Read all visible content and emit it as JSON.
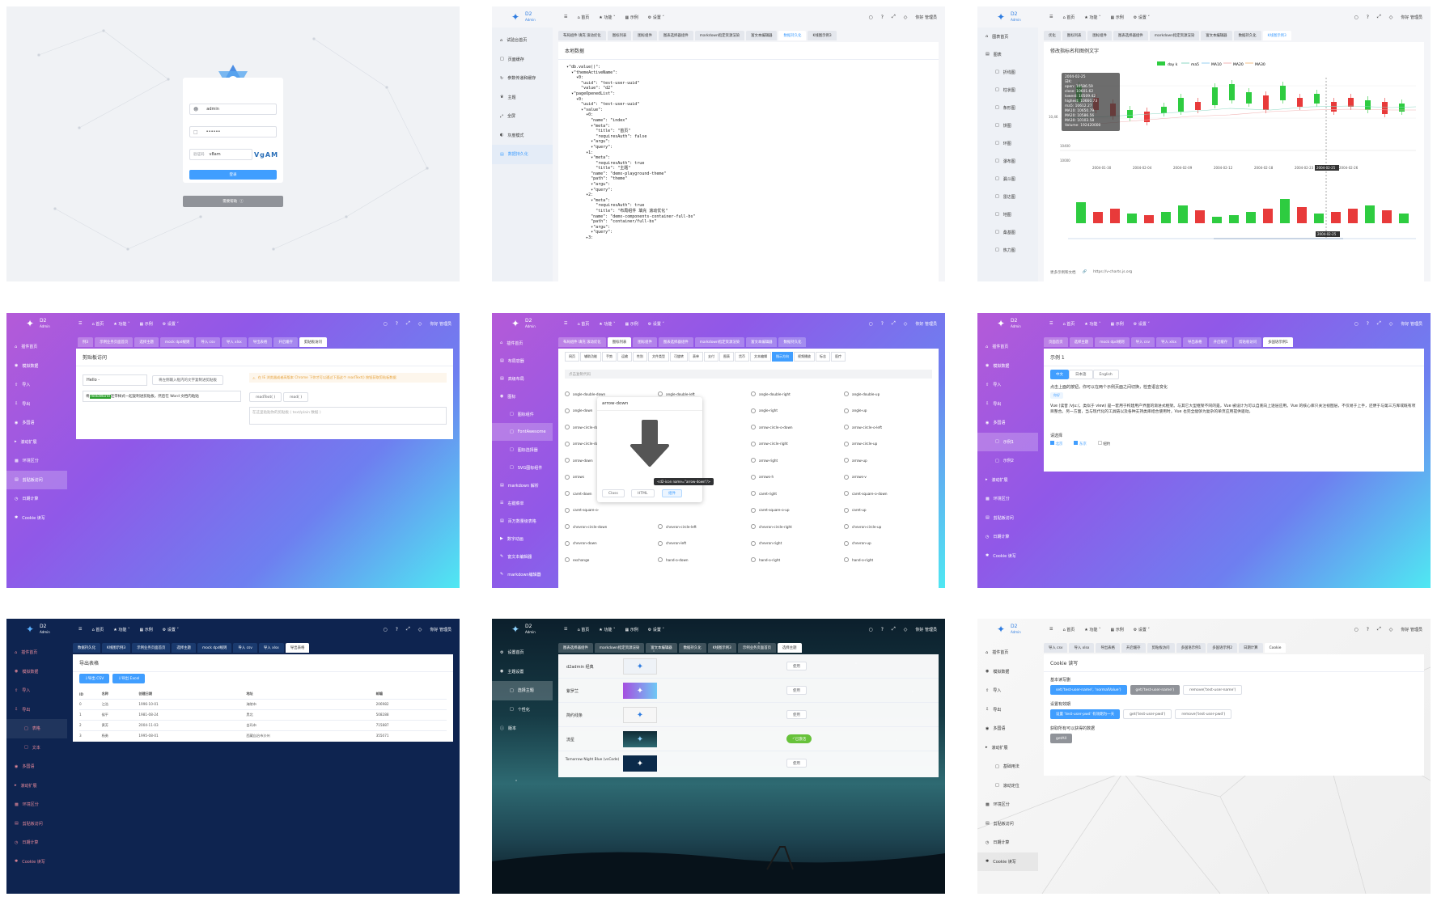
{
  "common": {
    "logo": "D2",
    "logo_sub": "Admin",
    "nav": [
      "首页",
      "功能",
      "示例",
      "设置"
    ],
    "user": "你好 管理员"
  },
  "p1": {
    "username": "admin",
    "password": "••••••",
    "code_ph": "验证码",
    "code_val": "v8am",
    "captcha": "VgAM",
    "login": "登录",
    "help": "需要帮助"
  },
  "p2": {
    "side": [
      "试验台首页",
      "页面缓存",
      "参数传递和缓存",
      "主题",
      "全屏",
      "灰度模式",
      "数据持久化"
    ],
    "tabs": [
      "布局组件 填充 滚动优化",
      "图标列表",
      "图标组件",
      "图表选择器组件",
      "markdown指定资源渲染",
      "富文本编辑器",
      "数据持久化",
      "K线图示例3"
    ],
    "title": "本地数据",
    "code": "▾\"db.value()\":\n  ▾\"themeActiveName\":\n    ▾0:\n      \"uuid\": \"test-user-uuid\"\n      \"value\": \"d2\"\n  ▾\"pageOpenedList\":\n    ▾0:\n      \"uuid\": \"test-user-uuid\"\n      ▾\"value\":\n        ▾0:\n          \"name\": \"index\"\n          ▾\"meta\":\n            \"title\": \"首页\"\n            \"requiresAuth\": false\n          ▾\"argu\":\n          ▾\"query\":\n        ▾1:\n          ▾\"meta\":\n            \"requiresAuth\": true\n            \"title\": \"主题\"\n          \"name\": \"demo-playground-theme\"\n          \"path\": \"theme\"\n          ▾\"argu\":\n          ▾\"query\":\n        ▾2:\n          ▾\"meta\":\n            \"requiresAuth\": true\n            \"title\": \"布局组件 填充 滚动优化\"\n          \"name\": \"demo-components-container-full-bs\"\n          \"path\": \"container/full-bs\"\n          ▾\"argu\":\n          ▾\"query\":\n        ▸3:"
  },
  "p3": {
    "side": [
      "图表首页",
      "图表",
      "折线图",
      "柱状图",
      "条形图",
      "饼图",
      "环图",
      "瀑布图",
      "漏斗图",
      "雷达图",
      "地图",
      "桑基图",
      "热力图"
    ],
    "tabs": [
      "优化",
      "图标列表",
      "图标组件",
      "图表选择器组件",
      "markdown指定资源渲染",
      "富文本编辑器",
      "数据持久化",
      "K线图示例3"
    ],
    "title": "修改指标名和图例文字",
    "legend": [
      "day k",
      "ma5",
      "MA10",
      "MA20",
      "MA30"
    ],
    "tip": [
      "2004-02-25",
      "日K:",
      "open: 10586.59",
      "close: 10601.62",
      "lowest: 10509.42",
      "highest: 10660.73",
      "ma5: 10612.27",
      "MA10: 10650.79",
      "MA20: 10586.56",
      "MA30: 10103.58",
      "Volume: 192420000"
    ],
    "xticks": [
      "2004-01-30",
      "2004-02-04",
      "2004-02-09",
      "2004-02-12",
      "2004-02-18",
      "2004-02-23",
      "2004-02-26"
    ],
    "yticks": [
      "10400",
      "10000"
    ],
    "marker": "2004-02-25",
    "ylabel_left": "10,46",
    "bottom_link": "更多示例和文档",
    "bottom_url": "https://v-charts.js.org"
  },
  "p4": {
    "side": [
      "插件首页",
      "模拟数据",
      "导入",
      "导出",
      "多国语",
      "滚动扩展",
      "环境区分",
      "剪贴板访问",
      "日期计算",
      "Cookie 读写"
    ],
    "tabs": [
      "例3",
      "示例业务页面首页",
      "选择主题",
      "mock dpd规则",
      "导入 csv",
      "导入 xlsx",
      "导出表格",
      "开启缓存",
      "剪贴板访问"
    ],
    "title": "剪贴板访问",
    "input": "Hello -",
    "btn1": "将左侧输入框内的文字复制进剪贴板",
    "rich_pre": "将",
    "rich_hl": "HelloWorld",
    "rich_post": "连带样式一起复制进剪贴板，然后在 Word 文档内粘贴",
    "warn": "在 IE 浏览器或者高版本 Chrome 下你才可以通过下面这个 readText() 按钮获取剪贴板数据",
    "btn2": "readText( )",
    "btn3": "read( )",
    "ta_ph": "在这里粘贴你的剪贴板 ( text/plain 数据 )"
  },
  "p5": {
    "side": [
      "插件首页",
      "布局容器",
      "高级布局",
      "图标",
      "图标组件",
      "FontAwesome",
      "图标选择器",
      "SVG图标组件",
      "markdown 解析",
      "右键菜单",
      "百万数量级表格",
      "数字动画",
      "富文本编辑器",
      "markdown编辑器"
    ],
    "tabs": [
      "布局组件 填充 滚动优化",
      "图标列表",
      "图标组件",
      "图表选择器组件",
      "markdown指定资源渲染",
      "富文本编辑器",
      "数据持久化"
    ],
    "cats": [
      "网页",
      "辅助功能",
      "手势",
      "运输",
      "性别",
      "文件类型",
      "可旋转",
      "表单",
      "支付",
      "图表",
      "货币",
      "文本编辑",
      "指示方向",
      "视频播放",
      "标志",
      "医疗"
    ],
    "search_ph": "点击复制代码",
    "icons": [
      [
        "angle-double-down",
        "angle-double-left",
        "angle-double-right",
        "angle-double-up"
      ],
      [
        "angle-down",
        "",
        "angle-right",
        "angle-up"
      ],
      [
        "arrow-circle-down",
        "",
        "arrow-circle-o-down",
        "arrow-circle-o-left"
      ],
      [
        "arrow-circle-down",
        "",
        "arrow-circle-right",
        "arrow-circle-up"
      ],
      [
        "arrow-down",
        "",
        "arrow-right",
        "arrow-up"
      ],
      [
        "arrows",
        "",
        "arrows-h",
        "arrows-v"
      ],
      [
        "caret-down",
        "",
        "caret-right",
        "caret-square-o-down"
      ],
      [
        "caret-square-o-",
        "",
        "caret-square-o-up",
        "caret-up"
      ],
      [
        "chevron-circle-down",
        "chevron-circle-left",
        "chevron-circle-right",
        "chevron-circle-up"
      ],
      [
        "chevron-down",
        "chevron-left",
        "chevron-right",
        "chevron-up"
      ],
      [
        "exchange",
        "hand-o-down",
        "hand-o-right",
        "hand-o-right"
      ]
    ],
    "pop_title": "arrow-down",
    "pop_tip": "<d2-icon name=\"arrow-down\"/>",
    "pop_btns": [
      "Class",
      "HTML",
      "组件"
    ]
  },
  "p6": {
    "side": [
      "插件首页",
      "模拟数据",
      "导入",
      "导出",
      "多国语",
      "示例1",
      "示例2",
      "滚动扩展",
      "环境区分",
      "剪贴板访问",
      "日期计算",
      "Cookie 读写"
    ],
    "tabs": [
      "页面首页",
      "选择主题",
      "mock dpd规则",
      "导入 csv",
      "导入 xlsx",
      "导出表格",
      "开启缓存",
      "剪贴板访问",
      "多国语示例1"
    ],
    "title": "示例 1",
    "langs": [
      "中文",
      "日本語",
      "English"
    ],
    "tip": "点击上面的按钮，你可以在两个示例页面之间切换，检查语言变化",
    "tag": "你好",
    "para": "Vue (读音 /vjuː/，类似于 view) 是一套用于构建用户界面的渐进式框架。与其它大型框架不同的是，Vue 被设计为可以自底向上逐层应用。Vue 的核心库只关注视图层，不仅易于上手，还便于与第三方库或既有项目整合。另一方面，当与现代化的工具链以及各种支持类库结合使用时，Vue 也完全能够为复杂的单页应用提供驱动。",
    "choose": "请选择",
    "checks": [
      "北京",
      "东京",
      "纽约"
    ]
  },
  "p7": {
    "side": [
      "插件首页",
      "模拟数据",
      "导入",
      "导出",
      "表格",
      "文本",
      "多国语",
      "滚动扩展",
      "环境区分",
      "剪贴板访问",
      "日期计算",
      "Cookie 读写"
    ],
    "tabs": [
      "数据持久化",
      "K线图示例3",
      "示例业务页面首页",
      "选择主题",
      "mock dpd规则",
      "导入 csv",
      "导入 xlsx",
      "导出表格"
    ],
    "title": "导出表格",
    "btn_csv": "导出 CSV",
    "btn_excel": "导出 Excel",
    "cols": [
      "ID",
      "名称",
      "创建日期",
      "地址",
      "邮编"
    ],
    "rows": [
      [
        "0",
        "江浩",
        "1996-10-01",
        "海陵市",
        "206982"
      ],
      [
        "1",
        "候平",
        "1981-08-24",
        "黑北",
        "508288"
      ],
      [
        "2",
        "黄芳",
        "2004-11-03",
        "白玛市",
        "715887"
      ],
      [
        "3",
        "杨勇",
        "1995-08-01",
        "西藏自治市沙州",
        "355071"
      ]
    ]
  },
  "p8": {
    "side": [
      "设置首页",
      "主题设置",
      "选择主题",
      "个性化",
      "版本"
    ],
    "tabs": [
      "图表选择器组件",
      "markdown指定资源渲染",
      "富文本编辑器",
      "数据持久化",
      "K线图示例3",
      "示例业务页面首页",
      "选择主题"
    ],
    "themes": [
      [
        "d2admin 经典",
        "使用"
      ],
      [
        "紫罗兰",
        "使用"
      ],
      [
        "简约线条",
        "使用"
      ],
      [
        "流星",
        "已激活"
      ],
      [
        "Tomorrow Night Blue (vsCode)",
        "使用"
      ]
    ]
  },
  "p9": {
    "side": [
      "插件首页",
      "模拟数据",
      "导入",
      "导出",
      "多国语",
      "滚动扩展",
      "基础用法",
      "滚动定位",
      "环境区分",
      "剪贴板访问",
      "日期计算",
      "Cookie 读写"
    ],
    "tabs": [
      "导入 csv",
      "导入 xlsx",
      "导出表格",
      "开启缓存",
      "剪贴板访问",
      "多国语示例1",
      "多国语示例2",
      "日期计算",
      "Cookie"
    ],
    "title": "Cookie 读写",
    "s1": "基本读写删",
    "b1": [
      "set('test-user-name', 'normalValue')",
      "get('test-user-name')",
      "remove('test-user-name')"
    ],
    "s2": "设置有效期",
    "b2": [
      "设置 'test-user-pwd' 有效期为一天",
      "get('test-user-pwd')",
      "remove('test-user-pwd')"
    ],
    "s3": "获取所有可以获得的数据",
    "b3": "getAll"
  }
}
